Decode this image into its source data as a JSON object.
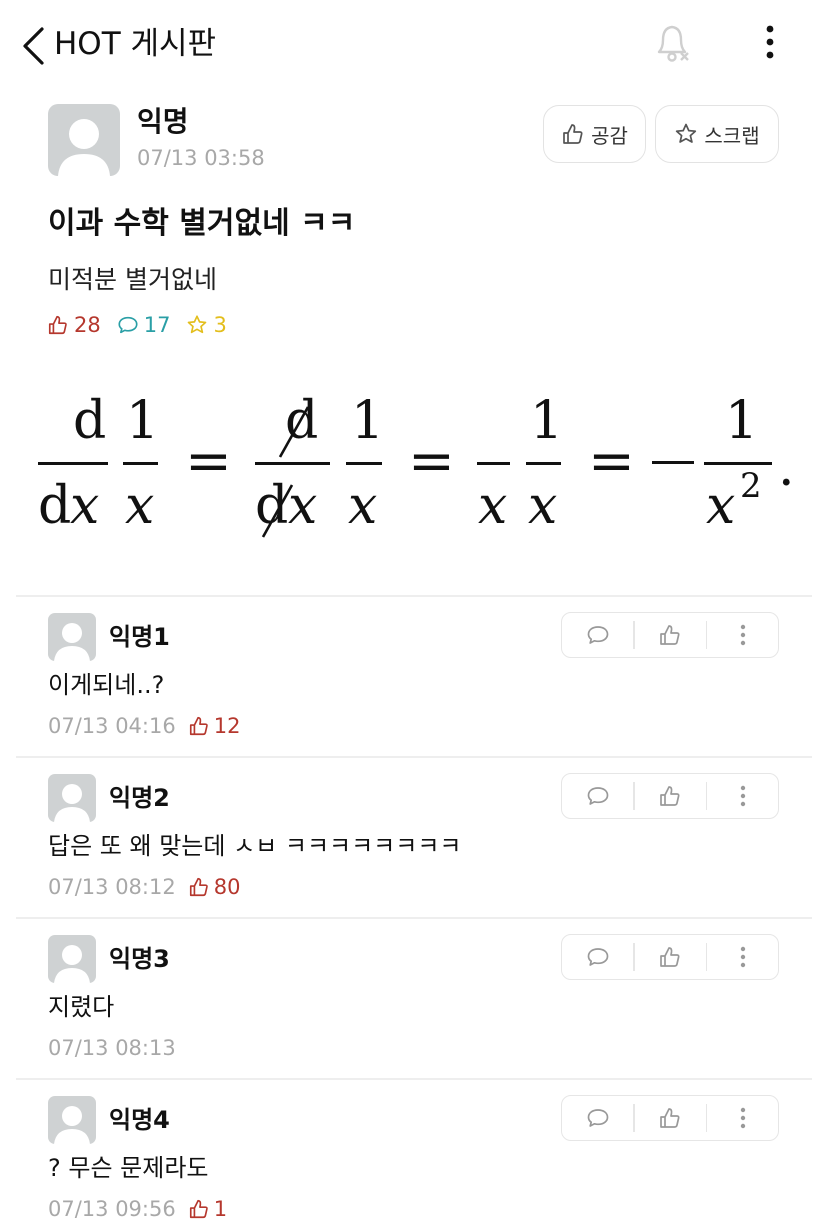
{
  "header": {
    "title": "HOT 게시판"
  },
  "post": {
    "author": "익명",
    "time": "07/13 03:58",
    "like_label": "공감",
    "scrap_label": "스크랩",
    "title": "이과 수학 별거없네 ㅋㅋ",
    "body": "미적분 별거없네",
    "likes": "28",
    "comments_count": "17",
    "scraps": "3",
    "formula": {
      "d": "d",
      "one": "1",
      "x": "x",
      "dx_d": "d",
      "eq": "=",
      "minus": "−",
      "sup": "2",
      "dot": "."
    }
  },
  "comments": [
    {
      "author": "익명1",
      "text": "이게되네..?",
      "time": "07/13 04:16",
      "likes": "12"
    },
    {
      "author": "익명2",
      "text": "답은 또 왜 맞는데 ㅅㅂ ㅋㅋㅋㅋㅋㅋㅋㅋ",
      "time": "07/13 08:12",
      "likes": "80"
    },
    {
      "author": "익명3",
      "text": "지렸다",
      "time": "07/13 08:13",
      "likes": ""
    },
    {
      "author": "익명4",
      "text": "? 무슨 문제라도",
      "time": "07/13 09:56",
      "likes": "1"
    }
  ],
  "colors": {
    "like": "#b5372d",
    "comment": "#2a9fa6",
    "scrap": "#e3be1c",
    "meta": "#a8a8a8",
    "avatar": "#cfd2d3"
  },
  "icons": [
    "back-arrow-icon",
    "bell-off-icon",
    "more-vertical-icon",
    "thumbs-up-icon",
    "star-icon",
    "speech-bubble-icon",
    "avatar-icon"
  ]
}
